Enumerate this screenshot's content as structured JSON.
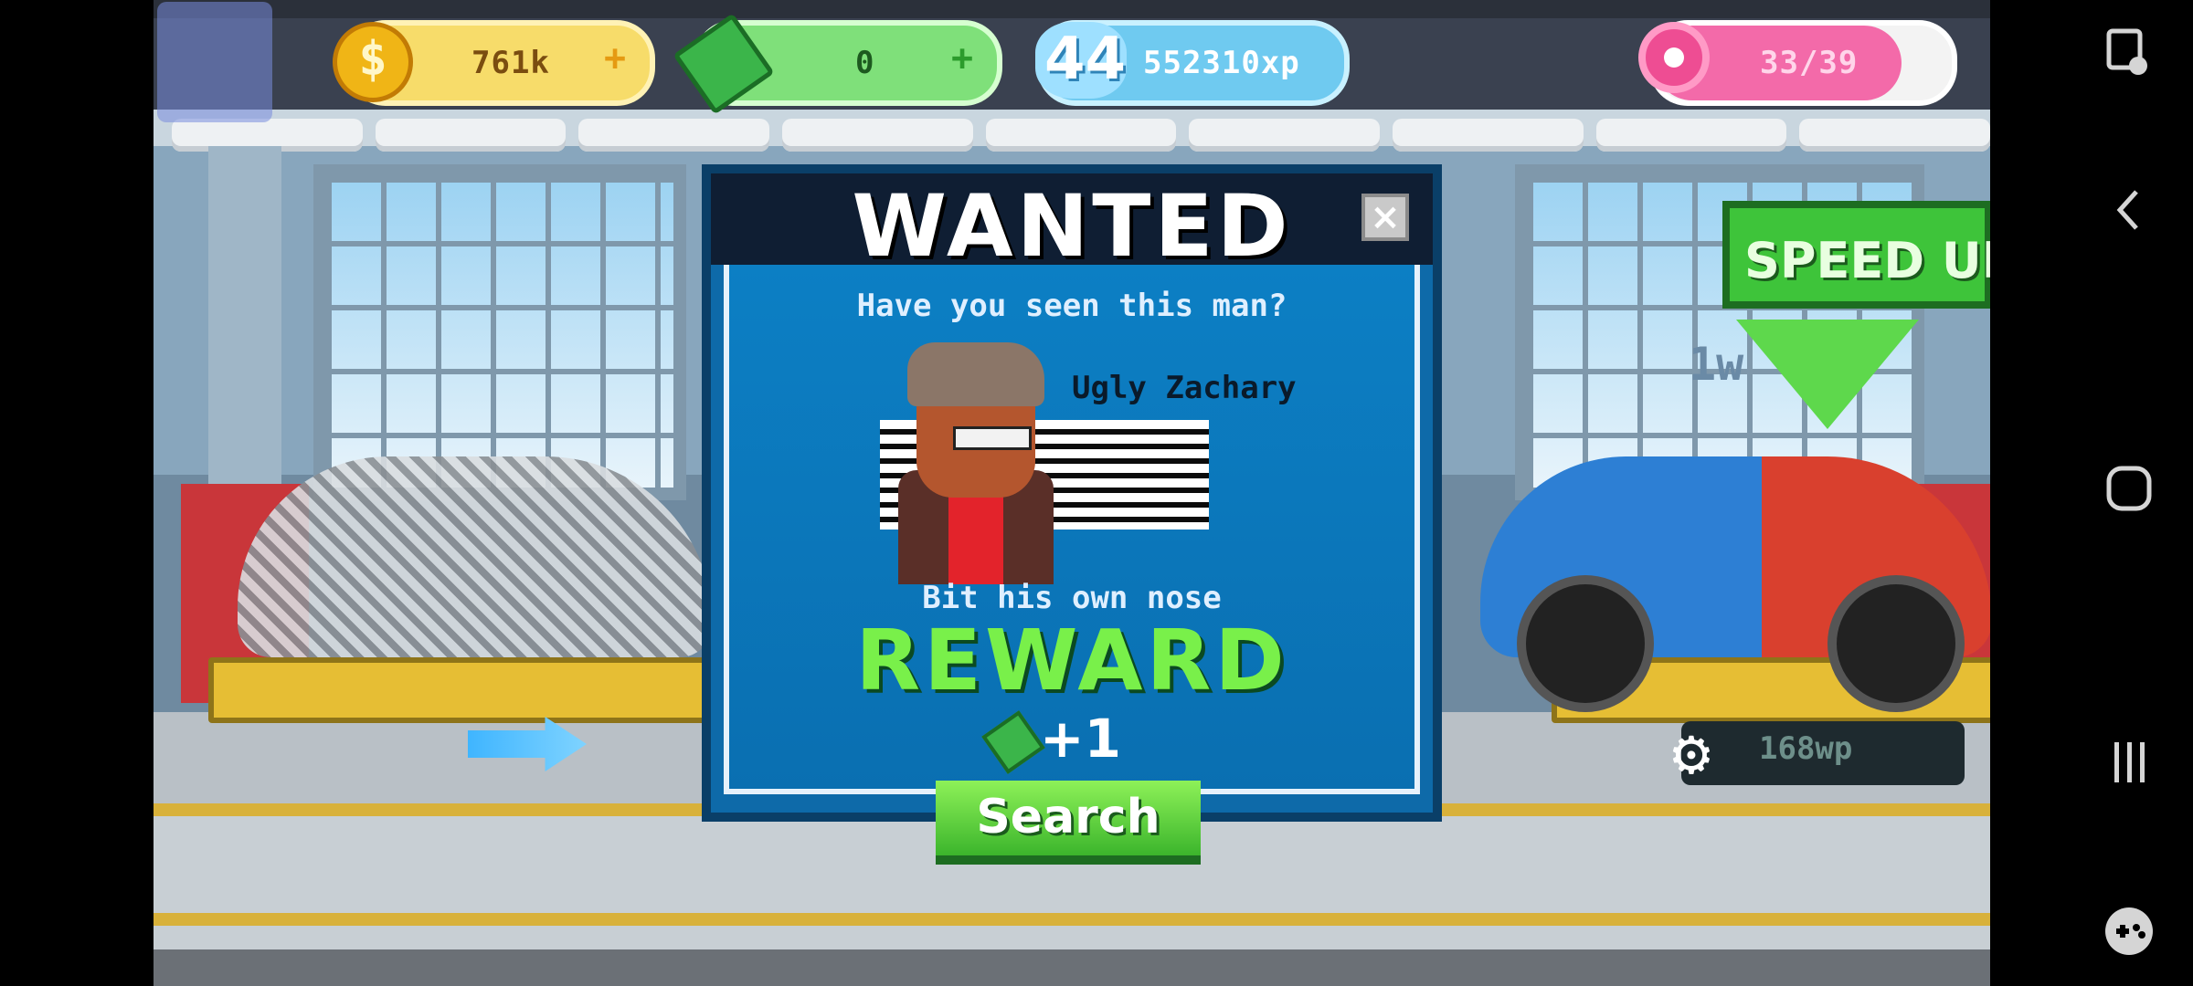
{
  "hud": {
    "coins": "761k",
    "cash": "0",
    "level": "44",
    "xp": "552310xp",
    "donuts": "33/39"
  },
  "dialog": {
    "title": "WANTED",
    "close": "×",
    "question": "Have you seen this man?",
    "name": "Ugly Zachary",
    "crime": "Bit his own nose",
    "reward_label": "REWARD",
    "reward_amount": "+1",
    "search_label": "Search"
  },
  "speedup": {
    "label": "SPEED UP",
    "hint": "1w"
  },
  "workshop": {
    "wp": "168wp"
  },
  "colors": {
    "wanted_bg": "#0e6aa9",
    "reward_green": "#79f04a",
    "search_green": "#3cb52c"
  },
  "icons": {
    "coin": "gold-coin-icon",
    "cash": "cash-icon",
    "level": "level-star-icon",
    "donut": "donut-icon",
    "gear": "gear-icon"
  }
}
